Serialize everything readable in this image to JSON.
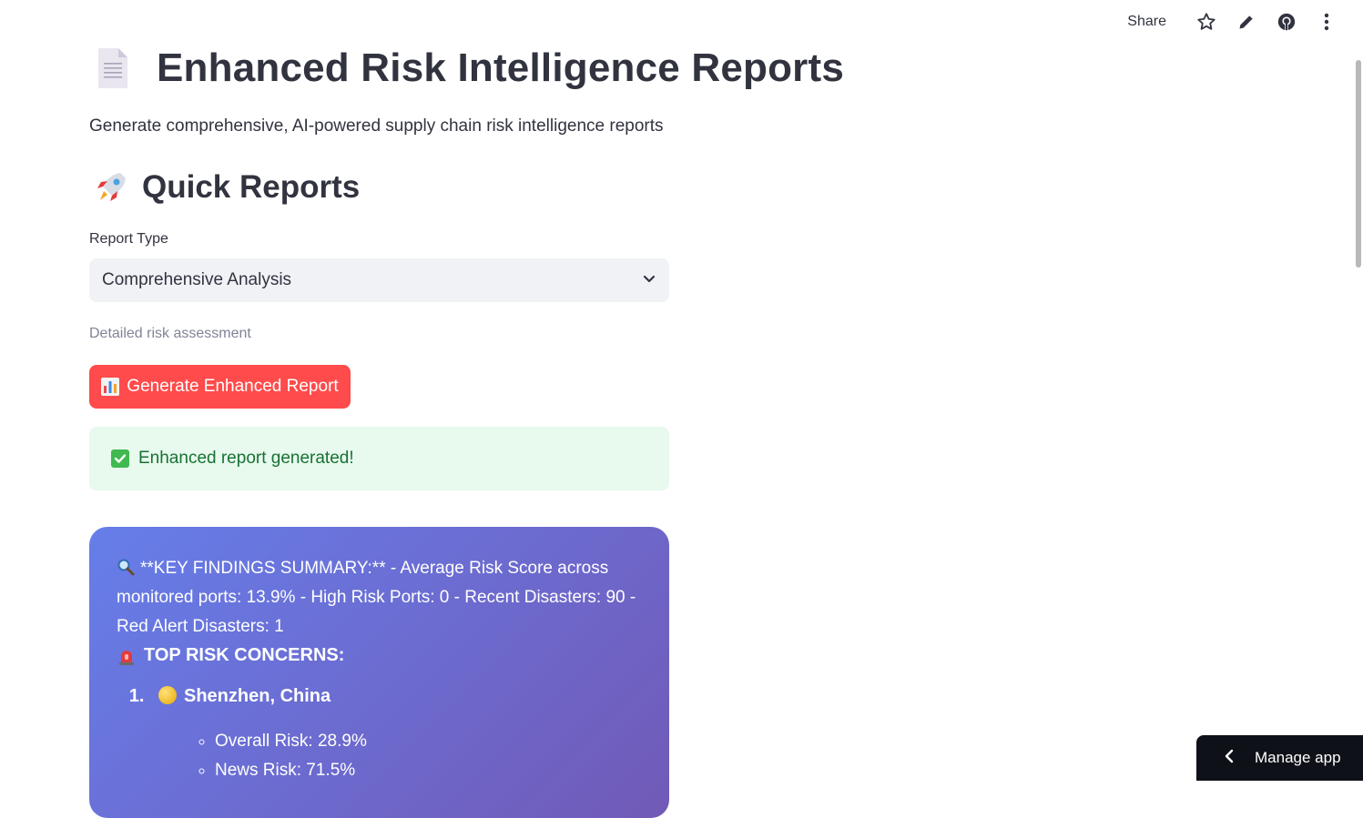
{
  "toolbar": {
    "share_label": "Share",
    "icons": [
      "star-icon",
      "pencil-icon",
      "github-icon",
      "more-vertical-icon"
    ]
  },
  "header": {
    "title": "Enhanced Risk Intelligence Reports",
    "subtitle": "Generate comprehensive, AI-powered supply chain risk intelligence reports"
  },
  "quick_reports": {
    "heading": "Quick Reports",
    "report_type_label": "Report Type",
    "report_type_value": "Comprehensive Analysis",
    "helper_text": "Detailed risk assessment",
    "generate_button": "Generate Enhanced Report",
    "success_message": "Enhanced report generated!"
  },
  "report": {
    "summary": "**KEY FINDINGS SUMMARY:** - Average Risk Score across monitored ports: 13.9% - High Risk Ports: 0 - Recent Disasters: 90 - Red Alert Disasters: 1",
    "concerns_heading": "TOP RISK CONCERNS:",
    "concerns": [
      {
        "name": "Shenzhen, China",
        "details": [
          "Overall Risk: 28.9%",
          "News Risk: 71.5%"
        ]
      }
    ]
  },
  "manage_app": {
    "label": "Manage app"
  },
  "colors": {
    "primary": "#ff4b4b",
    "success_bg": "#e8f9ee",
    "success_text": "#177233",
    "report_gradient_start": "#667eea",
    "report_gradient_end": "#764ba2"
  }
}
